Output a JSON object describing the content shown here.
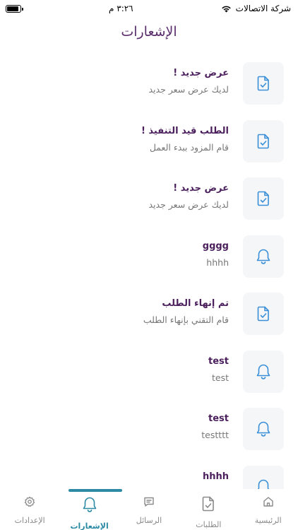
{
  "status_bar": {
    "carrier": "شركة الاتصالات",
    "time": "٣:٢٦ م",
    "battery_level": 0.9
  },
  "header": {
    "title": "الإشعارات"
  },
  "notifications": [
    {
      "icon": "document-check-icon",
      "title": "عرض جديد !",
      "body": "لديك عرض سعر جديد"
    },
    {
      "icon": "document-check-icon",
      "title": "الطلب قيد التنفيذ !",
      "body": "قام المزود ببدء العمل"
    },
    {
      "icon": "document-check-icon",
      "title": "عرض جديد !",
      "body": "لديك عرض سعر جديد"
    },
    {
      "icon": "bell-icon",
      "title": "gggg",
      "body": "hhhh"
    },
    {
      "icon": "document-check-icon",
      "title": "تم إنهاء الطلب",
      "body": "قام التقني بإنهاء الطلب"
    },
    {
      "icon": "bell-icon",
      "title": "test",
      "body": "test"
    },
    {
      "icon": "bell-icon",
      "title": "test",
      "body": "testttt"
    },
    {
      "icon": "bell-icon",
      "title": "hhhh",
      "body": ""
    }
  ],
  "tabs": [
    {
      "label": "الرئيسية",
      "icon": "home-icon",
      "active": false
    },
    {
      "label": "الطلبات",
      "icon": "document-check-icon",
      "active": false
    },
    {
      "label": "الرسائل",
      "icon": "message-icon",
      "active": false
    },
    {
      "label": "الإشعارات",
      "icon": "bell-icon",
      "active": true
    },
    {
      "label": "الإعدادات",
      "icon": "gear-icon",
      "active": false
    }
  ],
  "colors": {
    "accent": "#2c8aa5",
    "title_purple": "#5a2d6b",
    "item_title": "#4a1f5c",
    "icon_blue": "#3a8fd6"
  }
}
